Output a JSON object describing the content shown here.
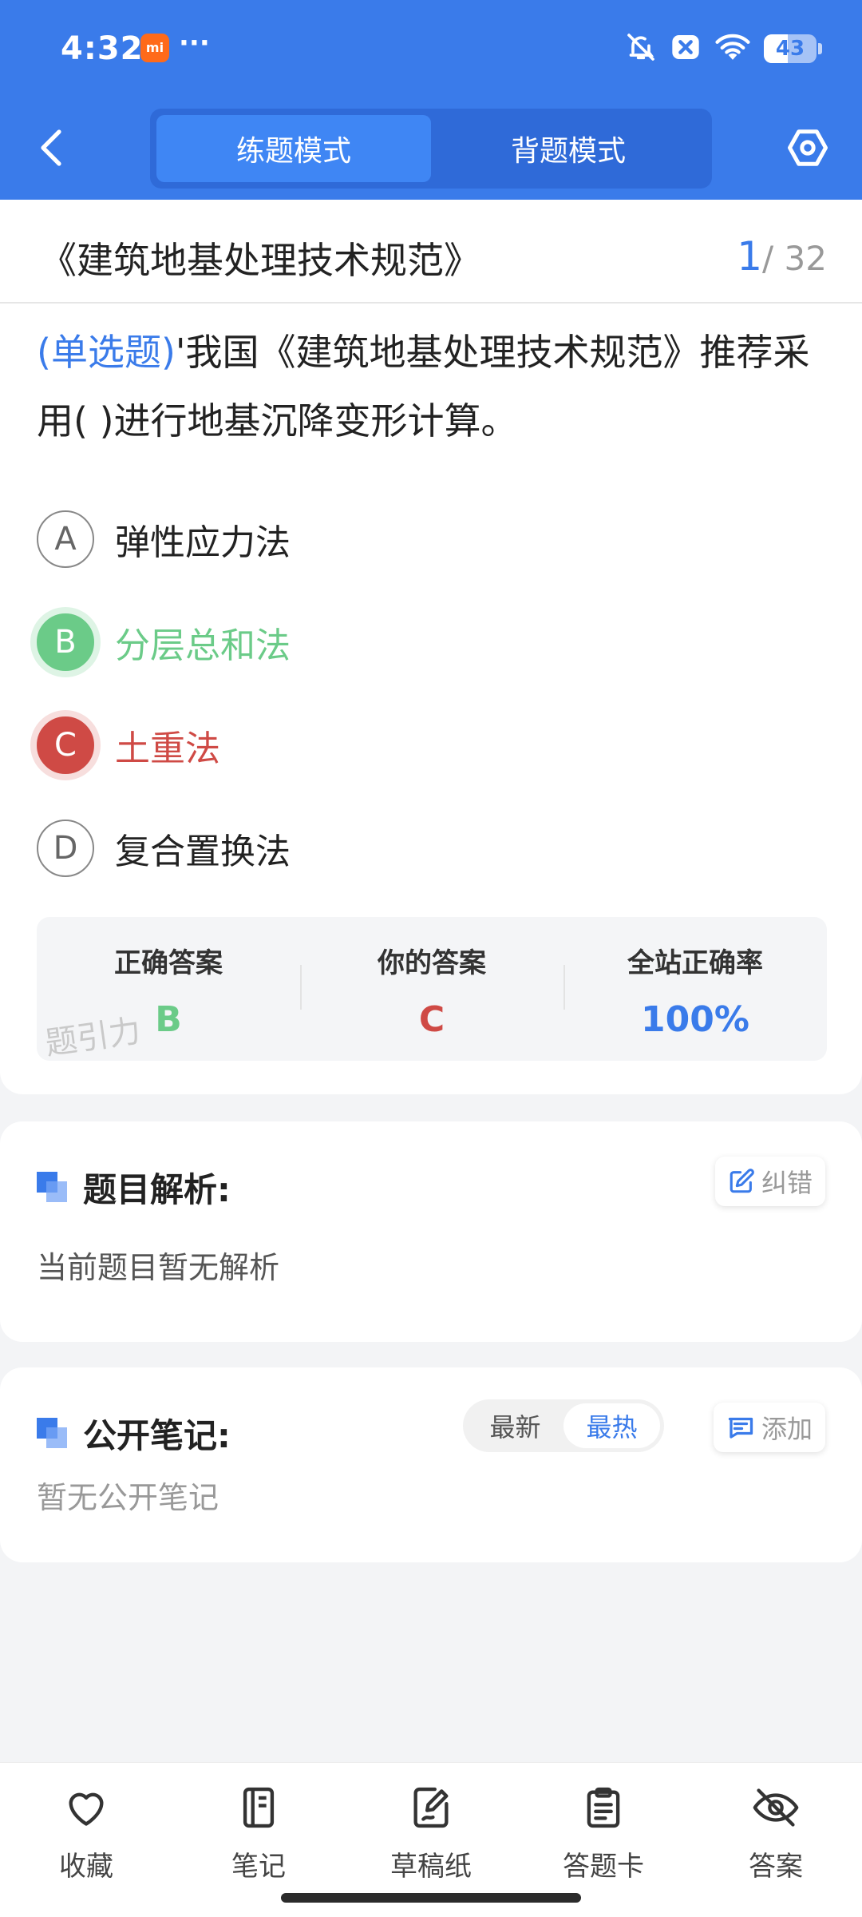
{
  "status_bar": {
    "time": "4:32",
    "app_badge": "mi",
    "more": "···",
    "battery": "43"
  },
  "header": {
    "modes": [
      "练题模式",
      "背题模式"
    ],
    "active_mode": "练题模式"
  },
  "question": {
    "book_title": "《建筑地基处理技术规范》",
    "current": "1",
    "total": "/ 32",
    "type": "(单选题)",
    "text": "'我国《建筑地基处理技术规范》推荐采用(        )进行地基沉降变形计算。",
    "options": [
      {
        "letter": "A",
        "text": "弹性应力法",
        "state": "normal"
      },
      {
        "letter": "B",
        "text": "分层总和法",
        "state": "correct"
      },
      {
        "letter": "C",
        "text": "土重法",
        "state": "wrong"
      },
      {
        "letter": "D",
        "text": "复合置换法",
        "state": "normal"
      }
    ]
  },
  "answer_summary": {
    "correct_label": "正确答案",
    "correct_value": "B",
    "yours_label": "你的答案",
    "yours_value": "C",
    "rate_label": "全站正确率",
    "rate_value": "100%",
    "watermark": "题引力"
  },
  "analysis": {
    "title": "题目解析:",
    "fix_label": "纠错",
    "body": "当前题目暂无解析"
  },
  "notes": {
    "title": "公开笔记:",
    "sort_options": [
      "最新",
      "最热"
    ],
    "active_sort": "最热",
    "add_label": "添加",
    "body": "暂无公开笔记"
  },
  "bottom_nav": [
    {
      "icon": "heart-icon",
      "label": "收藏"
    },
    {
      "icon": "notebook-icon",
      "label": "笔记"
    },
    {
      "icon": "draft-paper-icon",
      "label": "草稿纸"
    },
    {
      "icon": "answer-sheet-icon",
      "label": "答题卡"
    },
    {
      "icon": "eye-off-icon",
      "label": "答案"
    }
  ],
  "colors": {
    "primary": "#3a7bea",
    "correct": "#6bcb88",
    "wrong": "#cf4a45"
  }
}
